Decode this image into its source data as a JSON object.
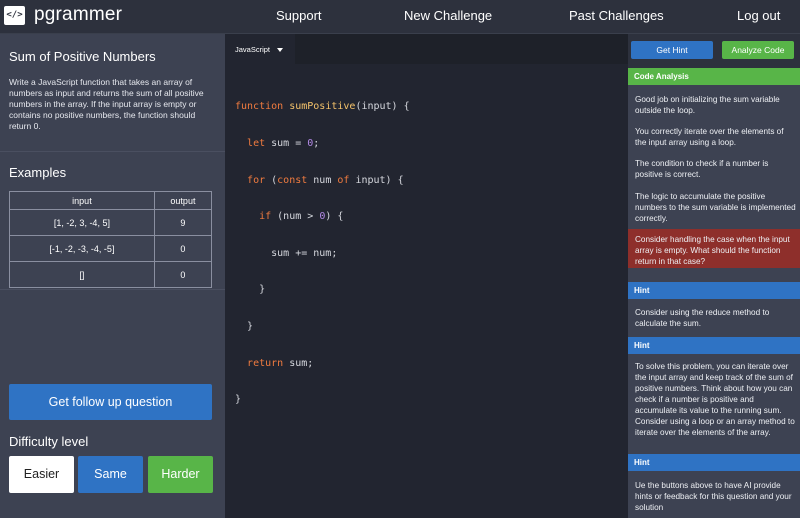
{
  "header": {
    "logo_glyph": "</>",
    "brand": "pgrammer",
    "nav": [
      {
        "label": "Support"
      },
      {
        "label": "New Challenge"
      },
      {
        "label": "Past Challenges"
      },
      {
        "label": "Log out"
      }
    ]
  },
  "problem": {
    "title": "Sum of Positive Numbers",
    "description": "Write a JavaScript function that takes an array of numbers as input and returns the sum of all positive numbers in the array. If the input array is empty or contains no positive numbers, the function should return 0."
  },
  "examples": {
    "title": "Examples",
    "columns": [
      "input",
      "output"
    ],
    "rows": [
      {
        "input": "[1, -2, 3, -4, 5]",
        "output": "9"
      },
      {
        "input": "[-1, -2, -3, -4, -5]",
        "output": "0"
      },
      {
        "input": "[]",
        "output": "0"
      }
    ]
  },
  "actions": {
    "followup": "Get follow up question",
    "difficulty_title": "Difficulty level",
    "easier": "Easier",
    "same": "Same",
    "harder": "Harder"
  },
  "editor": {
    "language": "JavaScript",
    "language_caret_icon": "caret-down-icon",
    "code_lines": [
      "function sumPositive(input) {",
      "  let sum = 0;",
      "  for (const num of input) {",
      "    if (num > 0) {",
      "      sum += num;",
      "    }",
      "  }",
      "  return sum;",
      "}"
    ]
  },
  "assistant": {
    "get_hint": "Get Hint",
    "analyze_code": "Analyze Code",
    "analysis_title": "Code Analysis",
    "analysis_items": [
      "Good job on initializing the sum variable outside the loop.",
      "You correctly iterate over the elements of the input array using a loop.",
      "The condition to check if a number is positive is correct.",
      "The logic to accumulate the positive numbers to the sum variable is implemented correctly."
    ],
    "analysis_warning": "Consider handling the case when the input array is empty. What should the function return in that case?",
    "hint_title": "Hint",
    "hint1": "Consider using the reduce method to calculate the sum.",
    "hint2": "To solve this problem, you can iterate over the input array and keep track of the sum of positive numbers. Think about how you can check if a number is positive and accumulate its value to the running sum. Consider using a loop or an array method to iterate over the elements of the array.",
    "hint3": "Ue the buttons above to have AI provide hints or feedback for this question and your solution"
  },
  "colors": {
    "accent_blue": "#2f73c4",
    "accent_green": "#58b548",
    "warning_red": "#8e2f2b"
  }
}
